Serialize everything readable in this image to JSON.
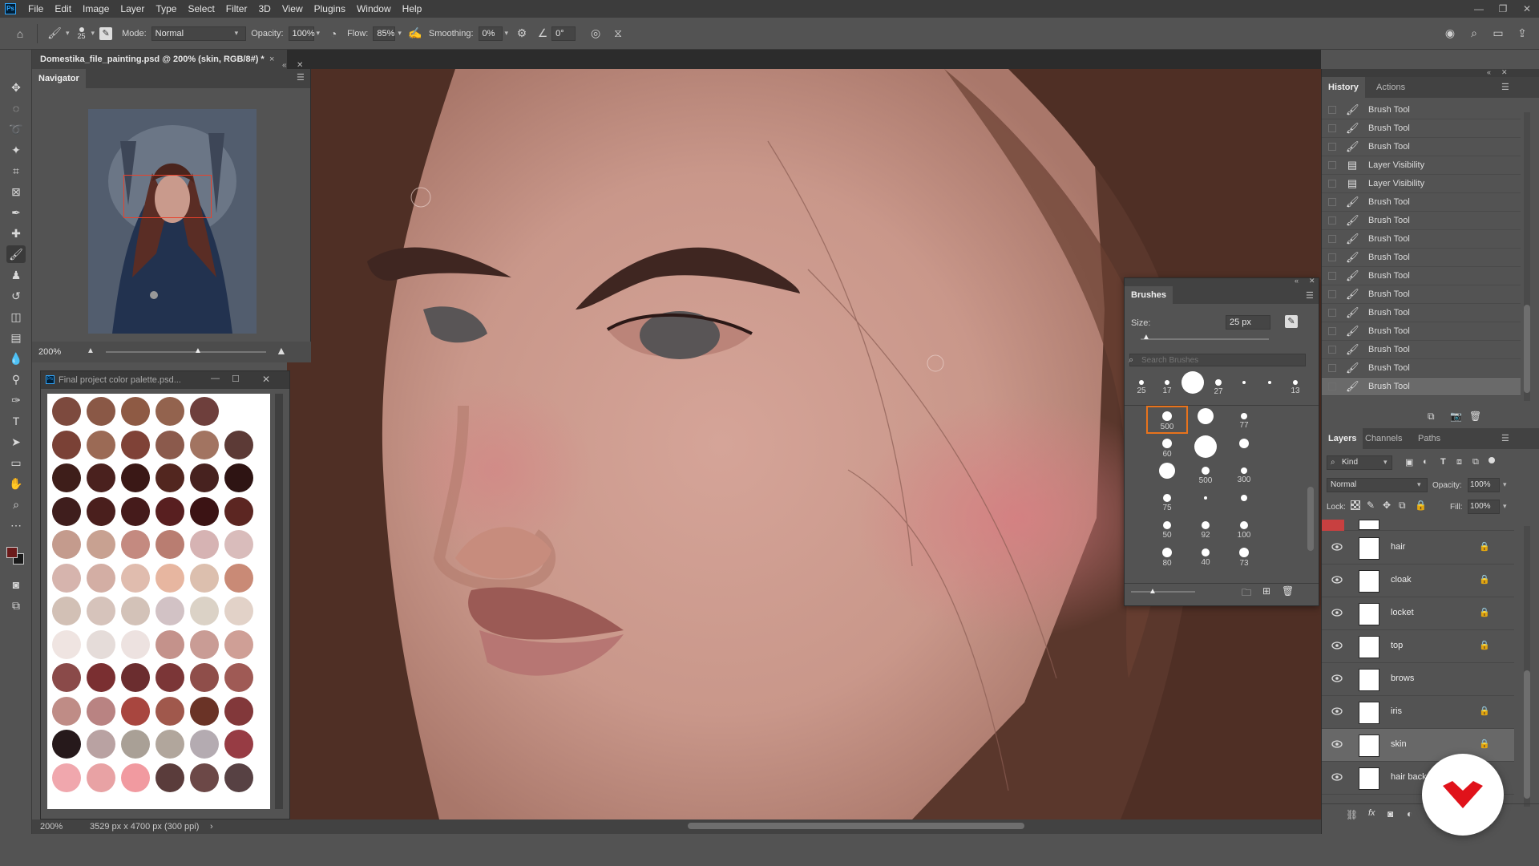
{
  "menubar": {
    "app_logo": "Ps",
    "items": [
      "File",
      "Edit",
      "Image",
      "Layer",
      "Type",
      "Select",
      "Filter",
      "3D",
      "View",
      "Plugins",
      "Window",
      "Help"
    ]
  },
  "options": {
    "brush_size": "25",
    "mode_label": "Mode:",
    "mode_value": "Normal",
    "opacity_label": "Opacity:",
    "opacity_value": "100%",
    "flow_label": "Flow:",
    "flow_value": "85%",
    "smoothing_label": "Smoothing:",
    "smoothing_value": "0%",
    "angle_value": "0°"
  },
  "document": {
    "tab_title": "Domestika_file_painting.psd @ 200% (skin, RGB/8#) *",
    "close": "×"
  },
  "navigator": {
    "tab": "Navigator",
    "zoom": "200%"
  },
  "palette_window": {
    "title": "Final project color palette.psd...",
    "logo": "Ps",
    "swatch_rows": [
      [
        "#7d4a3e",
        "#8a5846",
        "#8e5a44",
        "#93634e",
        "#6e3f3c"
      ],
      [
        "#7a4136",
        "#9b6a55",
        "#7f4237",
        "#8b5a4c",
        "#a27461",
        "#5c3a36"
      ],
      [
        "#3e1e1a",
        "#4a211e",
        "#3a1816",
        "#52261f",
        "#47221f",
        "#2e1413"
      ],
      [
        "#3f1e1d",
        "#4a1f1d",
        "#451b1b",
        "#581f20",
        "#3b1314",
        "#5c2622"
      ],
      [
        "#c49b8d",
        "#c8a191",
        "#c48a80",
        "#b97d71",
        "#d6b3b3",
        "#d9bcbb"
      ],
      [
        "#d6b4ad",
        "#d3aea4",
        "#e0bcae",
        "#e7b6a0",
        "#dcbfae",
        "#c98a76"
      ],
      [
        "#d2c0b5",
        "#d6c3bb",
        "#d3c2b8",
        "#d2c2c5",
        "#dbd2c6",
        "#e2d2c8"
      ],
      [
        "#efe4e1",
        "#e5dcd9",
        "#ede2e0",
        "#c4928b",
        "#c99c95",
        "#cf9f96"
      ],
      [
        "#8a4a49",
        "#7a2f31",
        "#6b2d2f",
        "#7b3637",
        "#8f4e4a",
        "#9f5a55"
      ],
      [
        "#bf8c86",
        "#b98382",
        "#a8463f",
        "#a0584c",
        "#6a3326",
        "#82383a"
      ],
      [
        "#26191b",
        "#b9a2a2",
        "#a9a096",
        "#b1a69c",
        "#b4abb1",
        "#973c44"
      ],
      [
        "#f0a7ad",
        "#e8a2a4",
        "#f19aa0",
        "#5a3c3b",
        "#6c4847",
        "#574143"
      ]
    ]
  },
  "history": {
    "tabs": [
      "History",
      "Actions"
    ],
    "items": [
      {
        "icon": "brush-icon",
        "label": "Brush Tool"
      },
      {
        "icon": "brush-icon",
        "label": "Brush Tool"
      },
      {
        "icon": "brush-icon",
        "label": "Brush Tool"
      },
      {
        "icon": "layer-visibility-icon",
        "label": "Layer Visibility"
      },
      {
        "icon": "layer-visibility-icon",
        "label": "Layer Visibility"
      },
      {
        "icon": "brush-icon",
        "label": "Brush Tool"
      },
      {
        "icon": "brush-icon",
        "label": "Brush Tool"
      },
      {
        "icon": "brush-icon",
        "label": "Brush Tool"
      },
      {
        "icon": "brush-icon",
        "label": "Brush Tool"
      },
      {
        "icon": "brush-icon",
        "label": "Brush Tool"
      },
      {
        "icon": "brush-icon",
        "label": "Brush Tool"
      },
      {
        "icon": "brush-icon",
        "label": "Brush Tool"
      },
      {
        "icon": "brush-icon",
        "label": "Brush Tool"
      },
      {
        "icon": "brush-icon",
        "label": "Brush Tool"
      },
      {
        "icon": "brush-icon",
        "label": "Brush Tool"
      },
      {
        "icon": "brush-icon",
        "label": "Brush Tool"
      }
    ]
  },
  "layers": {
    "tabs": [
      "Layers",
      "Channels",
      "Paths"
    ],
    "filter_label": "Kind",
    "blend_mode": "Normal",
    "opacity_label": "Opacity:",
    "opacity_value": "100%",
    "lock_label": "Lock:",
    "fill_label": "Fill:",
    "fill_value": "100%",
    "items": [
      {
        "name": "hair",
        "locked": true,
        "selected": false
      },
      {
        "name": "cloak",
        "locked": true,
        "selected": false
      },
      {
        "name": "locket",
        "locked": true,
        "selected": false
      },
      {
        "name": "top",
        "locked": true,
        "selected": false
      },
      {
        "name": "brows",
        "locked": false,
        "selected": false
      },
      {
        "name": "iris",
        "locked": true,
        "selected": false
      },
      {
        "name": "skin",
        "locked": true,
        "selected": true
      },
      {
        "name": "hair back",
        "locked": false,
        "selected": false
      }
    ],
    "footer_fx": "fx"
  },
  "brushes": {
    "title": "Brushes",
    "size_label": "Size:",
    "size_value": "25 px",
    "search_placeholder": "Search Brushes",
    "recent": [
      "25",
      "17",
      "",
      "27",
      "",
      "",
      "13"
    ],
    "grid_labels": [
      "500",
      "",
      "77",
      "60",
      "",
      "",
      "",
      "500",
      "300",
      "75",
      "",
      "",
      "50",
      "92",
      "100",
      "80",
      "40",
      "73"
    ]
  },
  "status": {
    "zoom": "200%",
    "doc_info": "3529 px x 4700 px (300 ppi)",
    "arrow": "›"
  },
  "colors": {
    "accent": "#31a8ff",
    "brand_red": "#e0121a",
    "foreground": "#6b1a1a",
    "background": "#1a1a1a"
  }
}
